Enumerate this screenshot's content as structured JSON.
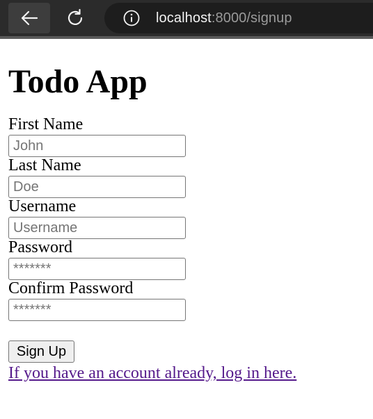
{
  "browser": {
    "url_host": "localhost",
    "url_path": ":8000/signup",
    "icons": {
      "back": "arrow-left-icon",
      "reload": "reload-icon",
      "info": "info-icon"
    }
  },
  "page": {
    "title": "Todo App",
    "fields": [
      {
        "label": "First Name",
        "placeholder": "John",
        "type": "text"
      },
      {
        "label": "Last Name",
        "placeholder": "Doe",
        "type": "text"
      },
      {
        "label": "Username",
        "placeholder": "Username",
        "type": "text"
      },
      {
        "label": "Password",
        "placeholder": "*******",
        "type": "password"
      },
      {
        "label": "Confirm Password",
        "placeholder": "*******",
        "type": "password"
      }
    ],
    "submit_label": "Sign Up",
    "login_link_text": "If you have an account already, log in here."
  },
  "colors": {
    "link_visited": "#551a8b",
    "browser_bar": "#2b2b2b"
  }
}
